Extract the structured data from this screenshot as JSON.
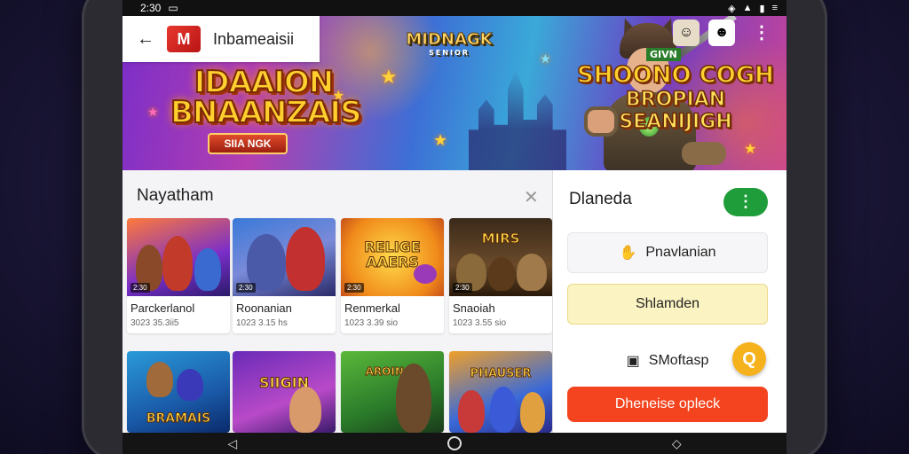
{
  "status_bar": {
    "time": "2:30",
    "sim_icon": "sim-icon",
    "right_icons": [
      "wifi-icon",
      "signal-icon",
      "battery-icon",
      "menu-icon"
    ]
  },
  "app_bar": {
    "back_icon": "back-arrow-icon",
    "logo_text": "M",
    "title": "Inbameaisii"
  },
  "banner": {
    "left_title": "IDAAION BNAANZAIS",
    "left_ribbon": "SIIA NGK",
    "center_title": "MIDNAGK",
    "center_sub": "SENIOR",
    "right_tag": "GIVN",
    "right_title_1": "SHOONO COGH",
    "right_title_2": "BROPIAN",
    "right_title_3": "SEANIJIGH"
  },
  "section": {
    "title": "Nayatham",
    "close_icon": "close-icon"
  },
  "games": [
    {
      "title": "Parckerlanol",
      "meta": "3023 35.3ii5",
      "badge": "2:30",
      "thumb_text": ""
    },
    {
      "title": "Roonanian",
      "meta": "1023 3.15 hs",
      "badge": "2:30",
      "thumb_text": ""
    },
    {
      "title": "Renmerkal",
      "meta": "1023 3.39 sio",
      "badge": "2:30",
      "thumb_text": "RELIGE AAERS"
    },
    {
      "title": "Snaoiah",
      "meta": "1023 3.55 sio",
      "badge": "2:30",
      "thumb_text": "MIRS"
    },
    {
      "title": "",
      "meta": "",
      "badge": "",
      "thumb_text": "BRAMAIS"
    },
    {
      "title": "",
      "meta": "",
      "badge": "",
      "thumb_text": "SIIGIN"
    },
    {
      "title": "",
      "meta": "",
      "badge": "",
      "thumb_text": "AROINAE"
    },
    {
      "title": "",
      "meta": "",
      "badge": "",
      "thumb_text": "PHAUSER"
    }
  ],
  "right_panel": {
    "title": "Dlaneda",
    "toggle_label": "⋮",
    "option_1": {
      "icon": "hand-icon",
      "label": "Pnavlanian"
    },
    "option_2": {
      "label": "Shlamden"
    },
    "option_3": {
      "icon": "briefcase-icon",
      "label": "SMoftasp"
    },
    "chat_icon": "chat-icon",
    "chat_glyph": "Q",
    "cta": "Dheneise opleck"
  },
  "nav": {
    "back": "◁",
    "home": "home-icon",
    "recent": "◇"
  }
}
